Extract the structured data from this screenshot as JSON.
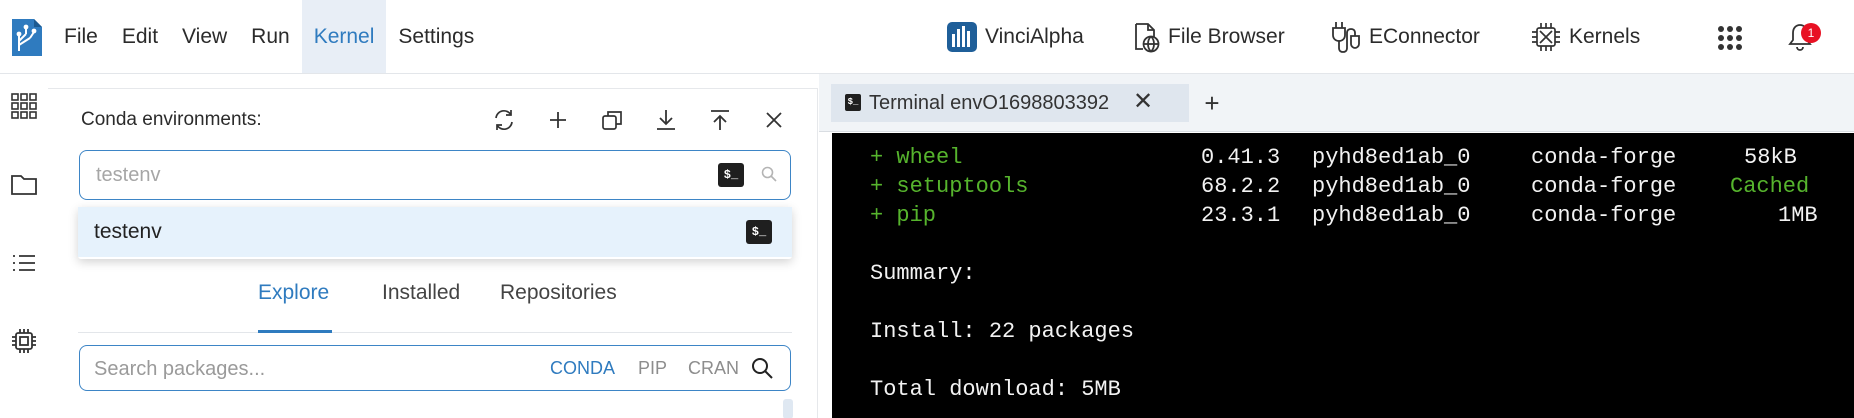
{
  "menu": {
    "items": [
      "File",
      "Edit",
      "View",
      "Run",
      "Kernel",
      "Settings"
    ],
    "active": "Kernel"
  },
  "tools": {
    "vincialpha": "VinciAlpha",
    "file_browser": "File Browser",
    "econnector": "EConnector",
    "kernels": "Kernels",
    "notification_count": "1"
  },
  "panel": {
    "title": "Conda environments:",
    "env_input": {
      "value": "",
      "placeholder": "testenv"
    },
    "dropdown_option": "testenv",
    "tabs": [
      "Explore",
      "Installed",
      "Repositories"
    ],
    "active_tab": "Explore",
    "package_search": {
      "placeholder": "Search packages...",
      "sources": [
        "CONDA",
        "PIP",
        "CRAN"
      ],
      "active_source": "CONDA"
    }
  },
  "terminal": {
    "tab_label": "Terminal envO1698803392",
    "packages": [
      {
        "name": "+ wheel",
        "version": "0.41.3",
        "build": "pyhd8ed1ab_0",
        "channel": "conda-forge",
        "size": "58kB"
      },
      {
        "name": "+ setuptools",
        "version": "68.2.2",
        "build": "pyhd8ed1ab_0",
        "channel": "conda-forge",
        "size": "Cached"
      },
      {
        "name": "+ pip",
        "version": "23.3.1",
        "build": "pyhd8ed1ab_0",
        "channel": "conda-forge",
        "size": "1MB"
      }
    ],
    "summary": "Summary:",
    "install": "Install: 22 packages",
    "total_download": "Total download: 5MB"
  },
  "colors": {
    "accent": "#2f7bbf",
    "terminal_bg": "#000000",
    "terminal_green": "#56b42d",
    "badge": "#e81123"
  },
  "icons": [
    "app-logo-icon",
    "vincialpha-icon",
    "file-browser-icon",
    "econnector-icon",
    "kernels-icon",
    "apps-grid-icon",
    "bell-icon",
    "refresh-icon",
    "plus-icon",
    "clone-icon",
    "download-icon",
    "upload-icon",
    "close-icon",
    "terminal-icon",
    "search-icon"
  ]
}
